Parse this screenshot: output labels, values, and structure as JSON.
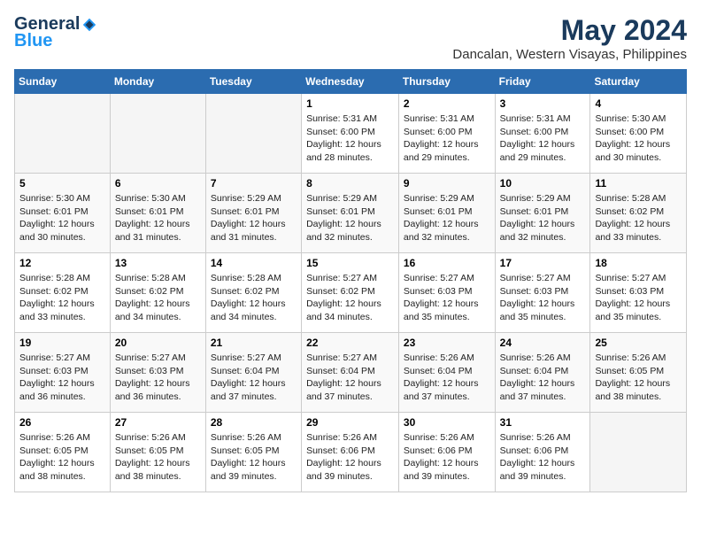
{
  "header": {
    "logo_general": "General",
    "logo_blue": "Blue",
    "month_year": "May 2024",
    "location": "Dancalan, Western Visayas, Philippines"
  },
  "days_of_week": [
    "Sunday",
    "Monday",
    "Tuesday",
    "Wednesday",
    "Thursday",
    "Friday",
    "Saturday"
  ],
  "weeks": [
    [
      {
        "day": "",
        "info": ""
      },
      {
        "day": "",
        "info": ""
      },
      {
        "day": "",
        "info": ""
      },
      {
        "day": "1",
        "info": "Sunrise: 5:31 AM\nSunset: 6:00 PM\nDaylight: 12 hours\nand 28 minutes."
      },
      {
        "day": "2",
        "info": "Sunrise: 5:31 AM\nSunset: 6:00 PM\nDaylight: 12 hours\nand 29 minutes."
      },
      {
        "day": "3",
        "info": "Sunrise: 5:31 AM\nSunset: 6:00 PM\nDaylight: 12 hours\nand 29 minutes."
      },
      {
        "day": "4",
        "info": "Sunrise: 5:30 AM\nSunset: 6:00 PM\nDaylight: 12 hours\nand 30 minutes."
      }
    ],
    [
      {
        "day": "5",
        "info": "Sunrise: 5:30 AM\nSunset: 6:01 PM\nDaylight: 12 hours\nand 30 minutes."
      },
      {
        "day": "6",
        "info": "Sunrise: 5:30 AM\nSunset: 6:01 PM\nDaylight: 12 hours\nand 31 minutes."
      },
      {
        "day": "7",
        "info": "Sunrise: 5:29 AM\nSunset: 6:01 PM\nDaylight: 12 hours\nand 31 minutes."
      },
      {
        "day": "8",
        "info": "Sunrise: 5:29 AM\nSunset: 6:01 PM\nDaylight: 12 hours\nand 32 minutes."
      },
      {
        "day": "9",
        "info": "Sunrise: 5:29 AM\nSunset: 6:01 PM\nDaylight: 12 hours\nand 32 minutes."
      },
      {
        "day": "10",
        "info": "Sunrise: 5:29 AM\nSunset: 6:01 PM\nDaylight: 12 hours\nand 32 minutes."
      },
      {
        "day": "11",
        "info": "Sunrise: 5:28 AM\nSunset: 6:02 PM\nDaylight: 12 hours\nand 33 minutes."
      }
    ],
    [
      {
        "day": "12",
        "info": "Sunrise: 5:28 AM\nSunset: 6:02 PM\nDaylight: 12 hours\nand 33 minutes."
      },
      {
        "day": "13",
        "info": "Sunrise: 5:28 AM\nSunset: 6:02 PM\nDaylight: 12 hours\nand 34 minutes."
      },
      {
        "day": "14",
        "info": "Sunrise: 5:28 AM\nSunset: 6:02 PM\nDaylight: 12 hours\nand 34 minutes."
      },
      {
        "day": "15",
        "info": "Sunrise: 5:27 AM\nSunset: 6:02 PM\nDaylight: 12 hours\nand 34 minutes."
      },
      {
        "day": "16",
        "info": "Sunrise: 5:27 AM\nSunset: 6:03 PM\nDaylight: 12 hours\nand 35 minutes."
      },
      {
        "day": "17",
        "info": "Sunrise: 5:27 AM\nSunset: 6:03 PM\nDaylight: 12 hours\nand 35 minutes."
      },
      {
        "day": "18",
        "info": "Sunrise: 5:27 AM\nSunset: 6:03 PM\nDaylight: 12 hours\nand 35 minutes."
      }
    ],
    [
      {
        "day": "19",
        "info": "Sunrise: 5:27 AM\nSunset: 6:03 PM\nDaylight: 12 hours\nand 36 minutes."
      },
      {
        "day": "20",
        "info": "Sunrise: 5:27 AM\nSunset: 6:03 PM\nDaylight: 12 hours\nand 36 minutes."
      },
      {
        "day": "21",
        "info": "Sunrise: 5:27 AM\nSunset: 6:04 PM\nDaylight: 12 hours\nand 37 minutes."
      },
      {
        "day": "22",
        "info": "Sunrise: 5:27 AM\nSunset: 6:04 PM\nDaylight: 12 hours\nand 37 minutes."
      },
      {
        "day": "23",
        "info": "Sunrise: 5:26 AM\nSunset: 6:04 PM\nDaylight: 12 hours\nand 37 minutes."
      },
      {
        "day": "24",
        "info": "Sunrise: 5:26 AM\nSunset: 6:04 PM\nDaylight: 12 hours\nand 37 minutes."
      },
      {
        "day": "25",
        "info": "Sunrise: 5:26 AM\nSunset: 6:05 PM\nDaylight: 12 hours\nand 38 minutes."
      }
    ],
    [
      {
        "day": "26",
        "info": "Sunrise: 5:26 AM\nSunset: 6:05 PM\nDaylight: 12 hours\nand 38 minutes."
      },
      {
        "day": "27",
        "info": "Sunrise: 5:26 AM\nSunset: 6:05 PM\nDaylight: 12 hours\nand 38 minutes."
      },
      {
        "day": "28",
        "info": "Sunrise: 5:26 AM\nSunset: 6:05 PM\nDaylight: 12 hours\nand 39 minutes."
      },
      {
        "day": "29",
        "info": "Sunrise: 5:26 AM\nSunset: 6:06 PM\nDaylight: 12 hours\nand 39 minutes."
      },
      {
        "day": "30",
        "info": "Sunrise: 5:26 AM\nSunset: 6:06 PM\nDaylight: 12 hours\nand 39 minutes."
      },
      {
        "day": "31",
        "info": "Sunrise: 5:26 AM\nSunset: 6:06 PM\nDaylight: 12 hours\nand 39 minutes."
      },
      {
        "day": "",
        "info": ""
      }
    ]
  ]
}
